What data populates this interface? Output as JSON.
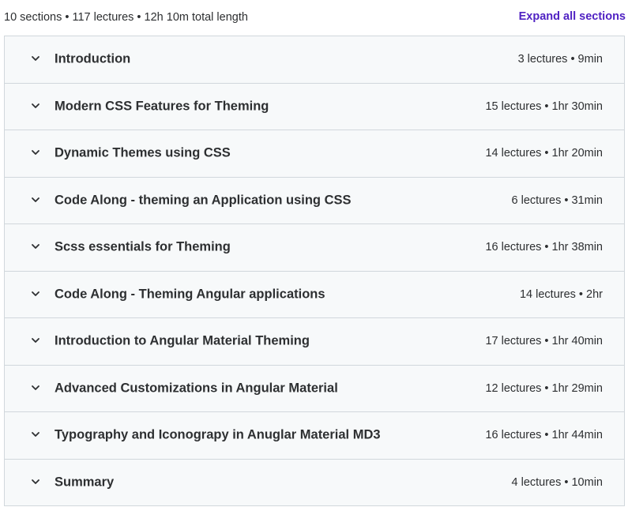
{
  "header": {
    "summary": "10 sections • 117 lectures • 12h 10m total length",
    "expand_label": "Expand all sections"
  },
  "colors": {
    "accent": "#5022c3",
    "section_bg": "#f7f9fa",
    "border": "#d1d7dc",
    "text": "#2d2f31"
  },
  "sections": [
    {
      "title": "Introduction",
      "meta": "3 lectures • 9min",
      "icon": "chevron-down-icon"
    },
    {
      "title": "Modern CSS Features for Theming",
      "meta": "15 lectures • 1hr 30min",
      "icon": "chevron-down-icon"
    },
    {
      "title": "Dynamic Themes using CSS",
      "meta": "14 lectures • 1hr 20min",
      "icon": "chevron-down-icon"
    },
    {
      "title": "Code Along - theming an Application using CSS",
      "meta": "6 lectures • 31min",
      "icon": "chevron-down-icon"
    },
    {
      "title": "Scss essentials for Theming",
      "meta": "16 lectures • 1hr 38min",
      "icon": "chevron-down-icon"
    },
    {
      "title": "Code Along - Theming Angular applications",
      "meta": "14 lectures • 2hr",
      "icon": "chevron-down-icon"
    },
    {
      "title": "Introduction to Angular Material Theming",
      "meta": "17 lectures • 1hr 40min",
      "icon": "chevron-down-icon"
    },
    {
      "title": "Advanced Customizations in Angular Material",
      "meta": "12 lectures • 1hr 29min",
      "icon": "chevron-down-icon"
    },
    {
      "title": "Typography and Iconograpy in Anuglar Material MD3",
      "meta": "16 lectures • 1hr 44min",
      "icon": "chevron-down-icon"
    },
    {
      "title": "Summary",
      "meta": "4 lectures • 10min",
      "icon": "chevron-down-icon"
    }
  ]
}
